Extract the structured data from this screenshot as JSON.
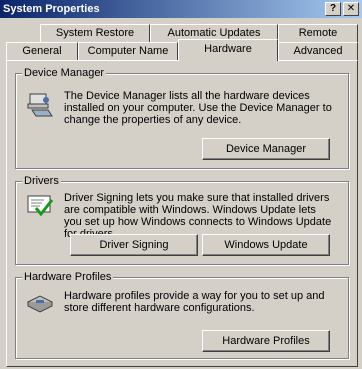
{
  "window": {
    "title": "System Properties",
    "help_button": "?",
    "close_button": "✕"
  },
  "tabs": {
    "row1": [
      "System Restore",
      "Automatic Updates",
      "Remote"
    ],
    "row2": [
      "General",
      "Computer Name",
      "Hardware",
      "Advanced"
    ],
    "active": "Hardware"
  },
  "device_manager": {
    "title": "Device Manager",
    "description": "The Device Manager lists all the hardware devices installed on your computer. Use the Device Manager to change the properties of any device.",
    "button": "Device Manager"
  },
  "drivers": {
    "title": "Drivers",
    "description": "Driver Signing lets you make sure that installed drivers are compatible with Windows. Windows Update lets you set up how Windows connects to Windows Update for drivers.",
    "driver_signing_button": "Driver Signing",
    "windows_update_button": "Windows Update"
  },
  "hardware_profiles": {
    "title": "Hardware Profiles",
    "description": "Hardware profiles provide a way for you to set up and store different hardware configurations.",
    "button": "Hardware Profiles"
  }
}
